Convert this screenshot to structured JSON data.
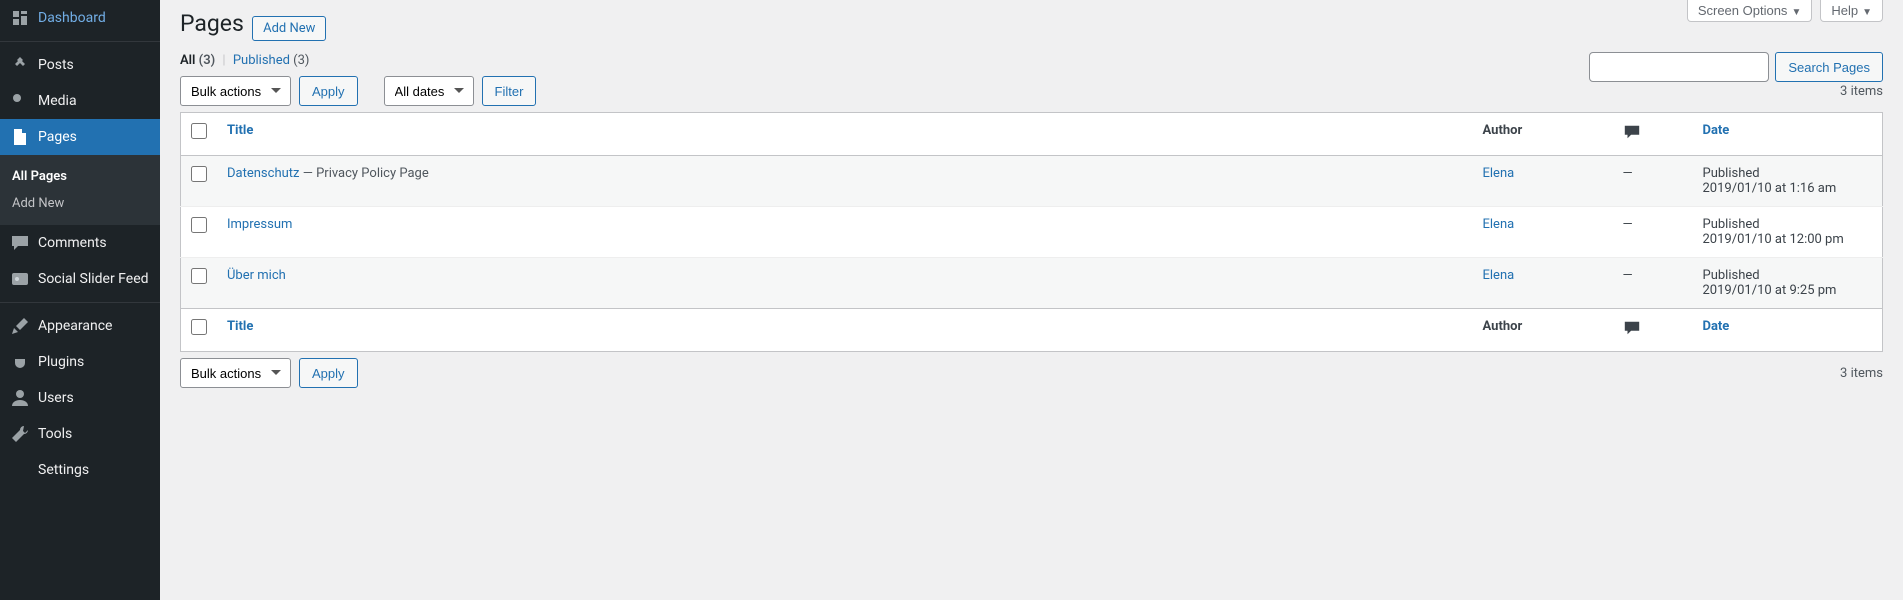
{
  "topbar": {
    "screen_options": "Screen Options",
    "help": "Help"
  },
  "sidebar": {
    "items": [
      {
        "label": "Dashboard",
        "icon": "dashboard"
      },
      {
        "label": "Posts",
        "icon": "pin"
      },
      {
        "label": "Media",
        "icon": "media"
      },
      {
        "label": "Pages",
        "icon": "page",
        "current": true
      },
      {
        "label": "Comments",
        "icon": "comment"
      },
      {
        "label": "Social Slider Feed",
        "icon": "feed"
      },
      {
        "label": "Appearance",
        "icon": "brush"
      },
      {
        "label": "Plugins",
        "icon": "plug"
      },
      {
        "label": "Users",
        "icon": "user"
      },
      {
        "label": "Tools",
        "icon": "wrench"
      },
      {
        "label": "Settings",
        "icon": "gear"
      }
    ],
    "submenu": [
      {
        "label": "All Pages",
        "current": true
      },
      {
        "label": "Add New"
      }
    ]
  },
  "header": {
    "title": "Pages",
    "add_new": "Add New"
  },
  "filter_links": {
    "all_label": "All",
    "all_count": "(3)",
    "published_label": "Published",
    "published_count": "(3)"
  },
  "search": {
    "button": "Search Pages"
  },
  "bulk": {
    "label": "Bulk actions",
    "apply": "Apply"
  },
  "dates": {
    "label": "All dates",
    "filter": "Filter"
  },
  "count_label": "3 items",
  "columns": {
    "title": "Title",
    "author": "Author",
    "date": "Date"
  },
  "rows": [
    {
      "title": "Datenschutz",
      "suffix": " — Privacy Policy Page",
      "author": "Elena",
      "comments": "—",
      "status": "Published",
      "date": "2019/01/10 at 1:16 am"
    },
    {
      "title": "Impressum",
      "suffix": "",
      "author": "Elena",
      "comments": "—",
      "status": "Published",
      "date": "2019/01/10 at 12:00 pm"
    },
    {
      "title": "Über mich",
      "suffix": "",
      "author": "Elena",
      "comments": "—",
      "status": "Published",
      "date": "2019/01/10 at 9:25 pm"
    }
  ]
}
